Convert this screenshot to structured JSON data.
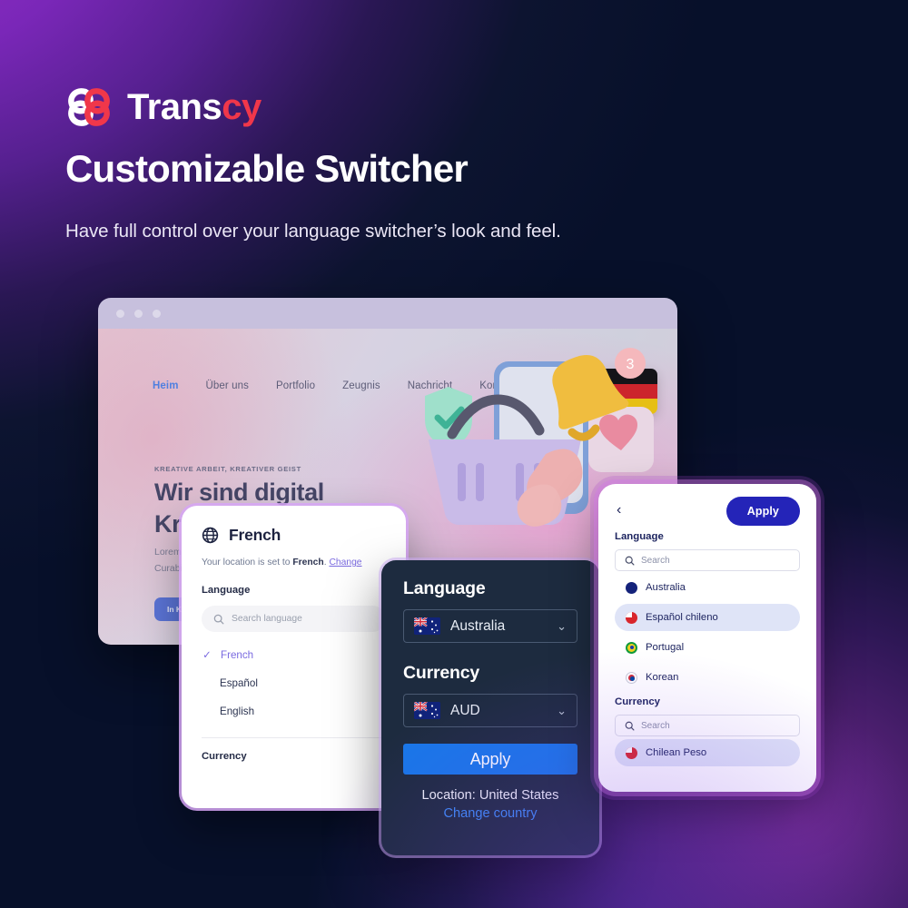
{
  "brand": {
    "name_main": "Trans",
    "name_accent": "cy",
    "logo_icon": "transcy-knot-logo",
    "accent_color": "#f0374a"
  },
  "hero": {
    "headline": "Customizable Switcher",
    "subhead": "Have full control over your language switcher’s look and feel."
  },
  "browser": {
    "dots": [
      "dot-1",
      "dot-2",
      "dot-3"
    ],
    "nav": [
      {
        "label": "Heim",
        "active": true
      },
      {
        "label": "Über uns",
        "active": false
      },
      {
        "label": "Portfolio",
        "active": false
      },
      {
        "label": "Zeugnis",
        "active": false
      },
      {
        "label": "Nachricht",
        "active": false
      },
      {
        "label": "Kontakt",
        "active": false
      }
    ],
    "flag": "germany-flag",
    "eyebrow": "KREATIVE ARBEIT, KREATIVER GEIST",
    "heading_line1": "Wir sind digital",
    "heading_line2": "Kreativagentur",
    "paragraph_line1": "Lorem ipsum dolor sit amet",
    "paragraph_line2": "Curabitur",
    "cta_label": "In Kontakt",
    "illustration": [
      "shield-check-3d",
      "shopping-basket-3d",
      "phone-hand-3d",
      "bell-notification-3d",
      "heart-card-3d"
    ],
    "bell_badge": "3"
  },
  "switcher_white": {
    "globe_icon": "globe-icon",
    "title": "French",
    "location_prefix": "Your location is set to ",
    "location_value": "French",
    "location_suffix": ".",
    "change_link": "Change",
    "language_label": "Language",
    "search_placeholder": "Search language",
    "languages": [
      {
        "label": "French",
        "selected": true
      },
      {
        "label": "Español",
        "selected": false
      },
      {
        "label": "English",
        "selected": false
      }
    ],
    "currency_label": "Currency",
    "accent_color": "#7a6ae0"
  },
  "switcher_dark": {
    "language_label": "Language",
    "language_value": "Australia",
    "language_flag": "australia-flag",
    "currency_label": "Currency",
    "currency_value": "AUD",
    "currency_flag": "australia-flag",
    "apply_label": "Apply",
    "location_text": "Location: United States",
    "change_country_label": "Change country",
    "accent_color": "#1877e8"
  },
  "switcher_right": {
    "back_icon": "chevron-left-icon",
    "apply_label": "Apply",
    "language_label": "Language",
    "language_search_placeholder": "Search",
    "languages": [
      {
        "label": "Australia",
        "flag": "australia-flag",
        "selected": false
      },
      {
        "label": "Español chileno",
        "flag": "chile-flag",
        "selected": true
      },
      {
        "label": "Portugal",
        "flag": "portugal-flag",
        "selected": false
      },
      {
        "label": "Korean",
        "flag": "korea-flag",
        "selected": false
      }
    ],
    "currency_label": "Currency",
    "currency_search_placeholder": "Search",
    "currencies": [
      {
        "label": "Chilean Peso",
        "flag": "chile-flag",
        "selected": true
      }
    ],
    "accent_color": "#2424b8"
  }
}
